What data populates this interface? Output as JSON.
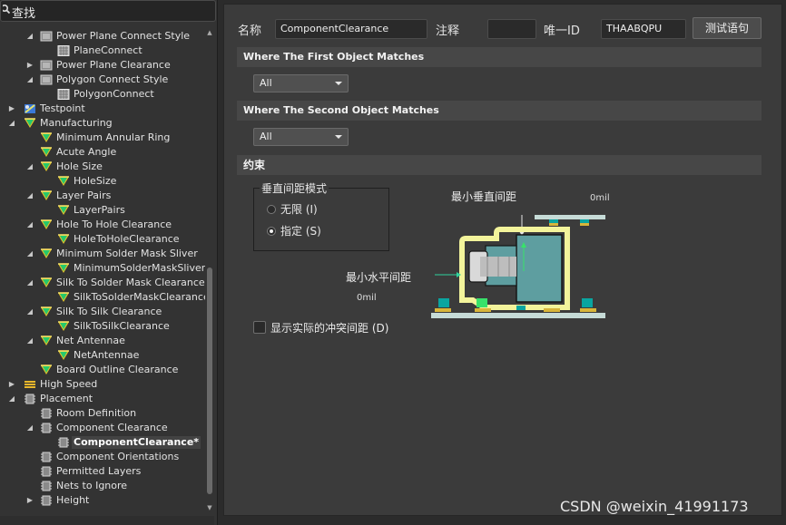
{
  "search": {
    "label": "查找"
  },
  "tree": {
    "rows": [
      {
        "label": "Power Plane Connect Style",
        "level": 2,
        "toggle": "open",
        "icon": "rule-icon"
      },
      {
        "label": "PlaneConnect",
        "level": 3,
        "toggle": "",
        "icon": "plane-icon"
      },
      {
        "label": "Power Plane Clearance",
        "level": 2,
        "toggle": "closed",
        "icon": "rule-icon"
      },
      {
        "label": "Polygon Connect Style",
        "level": 2,
        "toggle": "open",
        "icon": "rule-icon"
      },
      {
        "label": "PolygonConnect",
        "level": 3,
        "toggle": "",
        "icon": "plane-icon"
      },
      {
        "label": "Testpoint",
        "level": 1,
        "toggle": "closed",
        "icon": "testpoint-icon"
      },
      {
        "label": "Manufacturing",
        "level": 1,
        "toggle": "open",
        "icon": "manufacturing-icon"
      },
      {
        "label": "Minimum Annular Ring",
        "level": 2,
        "toggle": "",
        "icon": "manufacturing-icon"
      },
      {
        "label": "Acute Angle",
        "level": 2,
        "toggle": "",
        "icon": "manufacturing-icon"
      },
      {
        "label": "Hole Size",
        "level": 2,
        "toggle": "open",
        "icon": "manufacturing-icon"
      },
      {
        "label": "HoleSize",
        "level": 3,
        "toggle": "",
        "icon": "manufacturing-icon"
      },
      {
        "label": "Layer Pairs",
        "level": 2,
        "toggle": "open",
        "icon": "manufacturing-icon"
      },
      {
        "label": "LayerPairs",
        "level": 3,
        "toggle": "",
        "icon": "manufacturing-icon"
      },
      {
        "label": "Hole To Hole Clearance",
        "level": 2,
        "toggle": "open",
        "icon": "manufacturing-icon"
      },
      {
        "label": "HoleToHoleClearance",
        "level": 3,
        "toggle": "",
        "icon": "manufacturing-icon"
      },
      {
        "label": "Minimum Solder Mask Sliver",
        "level": 2,
        "toggle": "open",
        "icon": "manufacturing-icon"
      },
      {
        "label": "MinimumSolderMaskSliver",
        "level": 3,
        "toggle": "",
        "icon": "manufacturing-icon"
      },
      {
        "label": "Silk To Solder Mask Clearance",
        "level": 2,
        "toggle": "open",
        "icon": "manufacturing-icon"
      },
      {
        "label": "SilkToSolderMaskClearance",
        "level": 3,
        "toggle": "",
        "icon": "manufacturing-icon"
      },
      {
        "label": "Silk To Silk Clearance",
        "level": 2,
        "toggle": "open",
        "icon": "manufacturing-icon"
      },
      {
        "label": "SilkToSilkClearance",
        "level": 3,
        "toggle": "",
        "icon": "manufacturing-icon"
      },
      {
        "label": "Net Antennae",
        "level": 2,
        "toggle": "open",
        "icon": "manufacturing-icon"
      },
      {
        "label": "NetAntennae",
        "level": 3,
        "toggle": "",
        "icon": "manufacturing-icon"
      },
      {
        "label": "Board Outline Clearance",
        "level": 2,
        "toggle": "",
        "icon": "manufacturing-icon"
      },
      {
        "label": "High Speed",
        "level": 1,
        "toggle": "closed",
        "icon": "highspeed-icon"
      },
      {
        "label": "Placement",
        "level": 1,
        "toggle": "open",
        "icon": "placement-icon"
      },
      {
        "label": "Room Definition",
        "level": 2,
        "toggle": "",
        "icon": "placement-icon"
      },
      {
        "label": "Component Clearance",
        "level": 2,
        "toggle": "open",
        "icon": "placement-icon"
      },
      {
        "label": "ComponentClearance*",
        "level": 3,
        "toggle": "",
        "icon": "placement-icon",
        "selected": true
      },
      {
        "label": "Component Orientations",
        "level": 2,
        "toggle": "",
        "icon": "placement-icon"
      },
      {
        "label": "Permitted Layers",
        "level": 2,
        "toggle": "",
        "icon": "placement-icon"
      },
      {
        "label": "Nets to Ignore",
        "level": 2,
        "toggle": "",
        "icon": "placement-icon"
      },
      {
        "label": "Height",
        "level": 2,
        "toggle": "closed",
        "icon": "placement-icon"
      }
    ]
  },
  "header": {
    "name_label": "名称",
    "name_value": "ComponentClearance",
    "comment_label": "注释",
    "comment_value": "",
    "id_label": "唯一ID",
    "id_value": "THAABQPU",
    "test_button": "测试语句"
  },
  "first_match": {
    "title": "Where The First Object Matches",
    "selected": "All"
  },
  "second_match": {
    "title": "Where The Second Object Matches",
    "selected": "All"
  },
  "constraints": {
    "title": "约束",
    "mode_group": "垂直间距模式",
    "option_infinite": "无限 (I)",
    "option_specified": "指定 (S)",
    "selected_option": "specified",
    "min_vertical_label": "最小垂直间距",
    "min_vertical_value": "0mil",
    "min_horizontal_label": "最小水平间距",
    "min_horizontal_value": "0mil",
    "show_actual_label": "显示实际的冲突间距 (D)",
    "show_actual_checked": false
  },
  "watermark": "CSDN @weixin_41991173",
  "colors": {
    "board": "#c6dbd7",
    "body_fill": "#5e9ea0",
    "outline_yellow": "#f3f49b",
    "pad_teal": "#0aa5a0",
    "pad_green": "#38e26a",
    "pad_gold": "#d8b53a"
  }
}
